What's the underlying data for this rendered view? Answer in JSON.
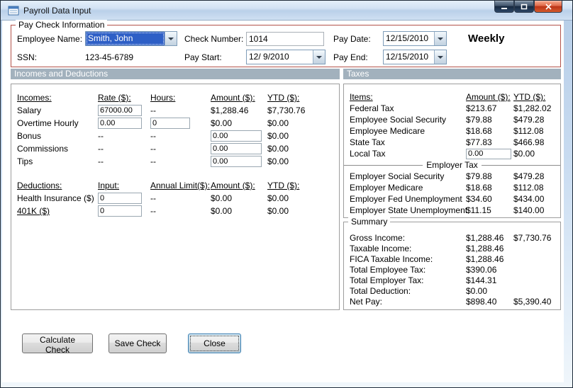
{
  "window": {
    "title": "Payroll Data Input"
  },
  "icons": {
    "app": "payroll-form-icon",
    "minimize": "minimize-bar",
    "maximize": "maximize-square",
    "close": "close-x",
    "combo_arrow": "chevron-down"
  },
  "colors": {
    "selection_blue": "#2E5FC6",
    "paycheck_border_red": "#B3524A",
    "section_band_gray": "#A2B1BD",
    "close_button_red": "#C23A1C"
  },
  "paycheck_info": {
    "legend": "Pay Check Information",
    "employee_name_label": "Employee Name:",
    "employee_name_value": "Smith, John",
    "ssn_label": "SSN:",
    "ssn_value": "123-45-6789",
    "check_number_label": "Check Number:",
    "check_number_value": "1014",
    "pay_start_label": "Pay Start:",
    "pay_start_value": "12/ 9/2010",
    "pay_date_label": "Pay Date:",
    "pay_date_value": "12/15/2010",
    "pay_end_label": "Pay End:",
    "pay_end_value": "12/15/2010",
    "frequency": "Weekly"
  },
  "sections": {
    "left": "Incomes and Deductions",
    "right": "Taxes"
  },
  "incomes": {
    "headers": {
      "name": "Incomes:",
      "rate": "Rate ($):",
      "hours": "Hours:",
      "amount": "Amount ($):",
      "ytd": "YTD ($):"
    },
    "rows": [
      {
        "label": "Salary",
        "rate": "67000.00",
        "hours": "--",
        "amount": "$1,288.46",
        "ytd": "$7,730.76"
      },
      {
        "label": "Overtime Hourly",
        "rate": "0.00",
        "hours": "0",
        "amount": "$0.00",
        "ytd": "$0.00"
      },
      {
        "label": "Bonus",
        "rate": "--",
        "hours": "--",
        "amount": "0.00",
        "ytd": "$0.00"
      },
      {
        "label": "Commissions",
        "rate": "--",
        "hours": "--",
        "amount": "0.00",
        "ytd": "$0.00"
      },
      {
        "label": "Tips",
        "rate": "--",
        "hours": "--",
        "amount": "0.00",
        "ytd": "$0.00"
      }
    ]
  },
  "deductions": {
    "headers": {
      "name": "Deductions:",
      "input": "Input:",
      "limit": "Annual Limit($):",
      "amount": "Amount ($):",
      "ytd": "YTD ($):"
    },
    "rows": [
      {
        "label": "Health Insurance  ($)",
        "input": "0",
        "limit": "--",
        "amount": "$0.00",
        "ytd": "$0.00"
      },
      {
        "label": "401K  ($)",
        "input": "0",
        "limit": "--",
        "amount": "$0.00",
        "ytd": "$0.00"
      }
    ]
  },
  "taxes": {
    "headers": {
      "name": "Items:",
      "amount": "Amount ($):",
      "ytd": "YTD ($):"
    },
    "employee_rows": [
      {
        "label": "Federal Tax",
        "amount": "$213.67",
        "ytd": "$1,282.02"
      },
      {
        "label": "Employee Social Security",
        "amount": "$79.88",
        "ytd": "$479.28"
      },
      {
        "label": "Employee Medicare",
        "amount": "$18.68",
        "ytd": "$112.08"
      },
      {
        "label": "State Tax",
        "amount": "$77.83",
        "ytd": "$466.98"
      },
      {
        "label": "Local Tax",
        "amount": "0.00",
        "ytd": "$0.00"
      }
    ],
    "employer_header": "Employer Tax",
    "employer_rows": [
      {
        "label": "Employer Social Security",
        "amount": "$79.88",
        "ytd": "$479.28"
      },
      {
        "label": "Employer Medicare",
        "amount": "$18.68",
        "ytd": "$112.08"
      },
      {
        "label": "Employer Fed Unemployment",
        "amount": "$34.60",
        "ytd": "$434.00"
      },
      {
        "label": "Employer State Unemployment",
        "amount": "$11.15",
        "ytd": "$140.00"
      }
    ]
  },
  "summary": {
    "legend": "Summary",
    "rows": [
      {
        "label": "Gross Income:",
        "amount": "$1,288.46",
        "ytd": "$7,730.76"
      },
      {
        "label": "Taxable Income:",
        "amount": "$1,288.46",
        "ytd": ""
      },
      {
        "label": "FICA Taxable Income:",
        "amount": "$1,288.46",
        "ytd": ""
      },
      {
        "label": "Total Employee Tax:",
        "amount": "$390.06",
        "ytd": ""
      },
      {
        "label": "Total Employer Tax:",
        "amount": "$144.31",
        "ytd": ""
      },
      {
        "label": "Total Deduction:",
        "amount": "$0.00",
        "ytd": ""
      },
      {
        "label": "Net Pay:",
        "amount": "$898.40",
        "ytd": "$5,390.40"
      }
    ]
  },
  "buttons": {
    "calculate": "Calculate Check",
    "save": "Save Check",
    "close": "Close"
  }
}
